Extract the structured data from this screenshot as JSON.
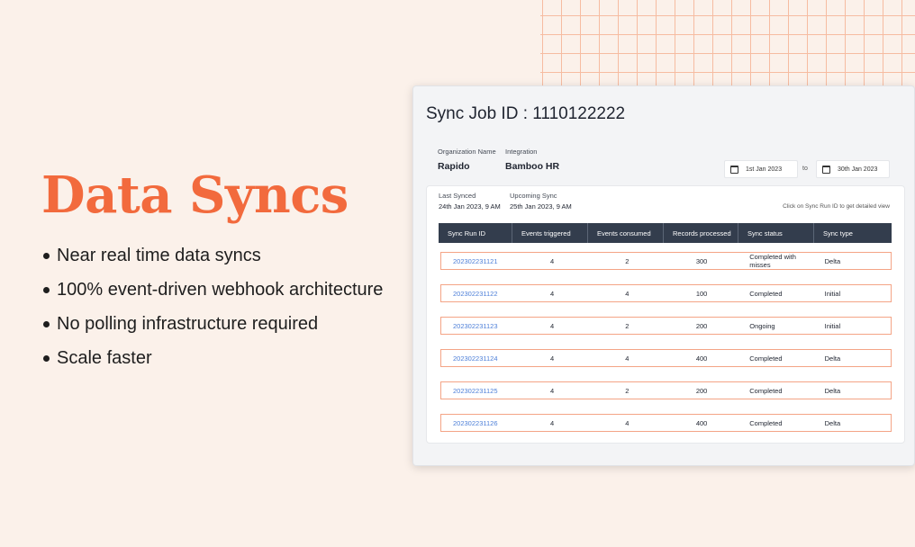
{
  "hero": {
    "title": "Data Syncs",
    "bullets": [
      "Near real time data syncs",
      "100% event-driven webhook architecture",
      "No polling infrastructure required",
      "Scale faster"
    ]
  },
  "job": {
    "title": "Sync Job ID : 1110122222",
    "org_label": "Organization Name",
    "org_value": "Rapido",
    "integration_label": "Integration",
    "integration_value": "Bamboo HR",
    "date_from": "1st Jan 2023",
    "date_to_label": "to",
    "date_to": "30th Jan 2023",
    "last_synced_label": "Last Synced",
    "last_synced_value": "24th Jan 2023, 9 AM",
    "upcoming_label": "Upcoming Sync",
    "upcoming_value": "25th Jan 2023, 9 AM",
    "hint": "Click on Sync Run ID to get detailed view"
  },
  "table": {
    "columns": [
      "Sync Run ID",
      "Events triggered",
      "Events consumed",
      "Records processed",
      "Sync status",
      "Sync type"
    ],
    "rows": [
      [
        "202302231121",
        "4",
        "2",
        "300",
        "Completed with misses",
        "Delta"
      ],
      [
        "202302231122",
        "4",
        "4",
        "100",
        "Completed",
        "Initial"
      ],
      [
        "202302231123",
        "4",
        "2",
        "200",
        "Ongoing",
        "Initial"
      ],
      [
        "202302231124",
        "4",
        "4",
        "400",
        "Completed",
        "Delta"
      ],
      [
        "202302231125",
        "4",
        "2",
        "200",
        "Completed",
        "Delta"
      ],
      [
        "202302231126",
        "4",
        "4",
        "400",
        "Completed",
        "Delta"
      ]
    ]
  },
  "colors": {
    "accent": "#f26a3d",
    "header_bg": "#333d4d",
    "link": "#4d7fd8",
    "row_border": "#f4a486"
  },
  "icons": {
    "date": "calendar-icon"
  }
}
